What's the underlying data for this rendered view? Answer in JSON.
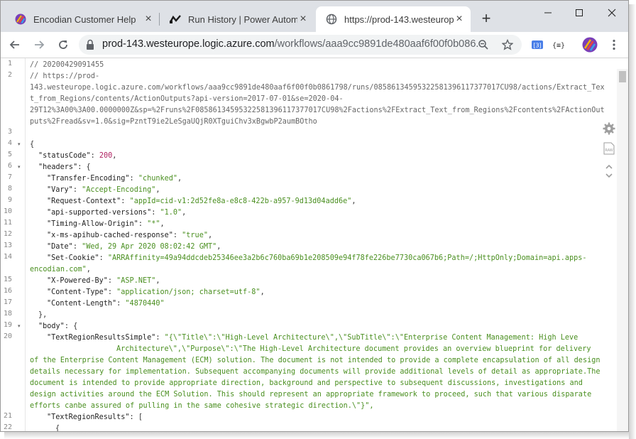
{
  "tabs": [
    {
      "title": "Encodian Customer Help",
      "icon": "encodian-logo-icon",
      "active": false
    },
    {
      "title": "Run History | Power Automat",
      "icon": "power-automate-icon",
      "active": false
    },
    {
      "title": "https://prod-143.westeurope",
      "icon": "globe-icon",
      "active": true
    }
  ],
  "toolbar": {
    "url_main": "prod-143.westeurope.logic.azure.com",
    "url_rest": "/workflows/aaa9cc9891de480aaf6f00f0b086..."
  },
  "code": {
    "line_numbers": [
      "1",
      "2",
      "",
      "",
      "",
      "",
      "3",
      "4",
      "5",
      "6",
      "7",
      "8",
      "9",
      "10",
      "11",
      "12",
      "13",
      "14",
      "",
      "15",
      "16",
      "17",
      "18",
      "19",
      "20",
      "",
      "",
      "",
      "",
      "",
      "",
      "21",
      "22"
    ],
    "l1": "// 20200429091455",
    "l2a": "// https://prod-",
    "l2b": "143.westeurope.logic.azure.com/workflows/aaa9cc9891de480aaf6f00f0b0861798/runs/08586134595322581396117377017CU98/actions/Extract_Tex",
    "l2c": "t_from_Regions/contents/ActionOutputs?api-version=2017-07-01&se=2020-04-",
    "l2d": "29T12%3A00%3A00.0000000Z&sp=%2Fruns%2F08586134595322581396117377017CU98%2Factions%2FExtract_Text_from_Regions%2Fcontents%2FActionOut",
    "l2e": "puts%2Fread&sv=1.0&sig=PzntT9ie2LeSgaUQjR0XTguiChv3xBgwbP2aumBOtho",
    "brace_open": "{",
    "statusCode_key": "\"statusCode\"",
    "statusCode_val": "200",
    "headers_key": "\"headers\"",
    "h": [
      {
        "k": "\"Transfer-Encoding\"",
        "v": "\"chunked\""
      },
      {
        "k": "\"Vary\"",
        "v": "\"Accept-Encoding\""
      },
      {
        "k": "\"Request-Context\"",
        "v": "\"appId=cid-v1:2d52fe8a-e8c8-422b-a957-9d13d04add6e\""
      },
      {
        "k": "\"api-supported-versions\"",
        "v": "\"1.0\""
      },
      {
        "k": "\"Timing-Allow-Origin\"",
        "v": "\"*\""
      },
      {
        "k": "\"x-ms-apihub-cached-response\"",
        "v": "\"true\""
      },
      {
        "k": "\"Date\"",
        "v": "\"Wed, 29 Apr 2020 08:02:42 GMT\""
      },
      {
        "k": "\"Set-Cookie\"",
        "v": "\"ARRAffinity=49a94ddcdeb25346ee3a2b6c760ba69b1e208509e94f78fe226be7730ca067b6;Path=/;HttpOnly;Domain=api.apps-"
      },
      {
        "k": "",
        "v": "encodian.com\""
      },
      {
        "k": "\"X-Powered-By\"",
        "v": "\"ASP.NET\""
      },
      {
        "k": "\"Content-Type\"",
        "v": "\"application/json; charset=utf-8\""
      },
      {
        "k": "\"Content-Length\"",
        "v": "\"4870440\""
      }
    ],
    "body_key": "\"body\"",
    "trs_key": "\"TextRegionResultsSimple\"",
    "trs_lines": [
      "\"{\\\"Title\\\":\\\"High-Level Architecture\\\",\\\"SubTitle\\\":\\\"Enterprise Content Management: High Leve",
      "Architecture\\\",\\\"Purpose\\\":\\\"The High-Level Architecture document provides an overview blueprint for delivery",
      "of the Enterprise Content Management (ECM) solution. The document is not intended to provide a complete encapsulation of all design",
      "details necessary for implementation. Subsequent accompanying documents will provide additional levels of detail as appropriate.The",
      "document is intended to provide appropriate direction, background and perspective to subsequent discussions, investigations and",
      "design activities around the ECM Solution. This should represent an appropriate framework to proceed, such that various disparate",
      "efforts canbe assured of pulling in the same cohesive strategic direction.\\\"}\","
    ],
    "trr_key": "\"TextRegionResults\""
  }
}
